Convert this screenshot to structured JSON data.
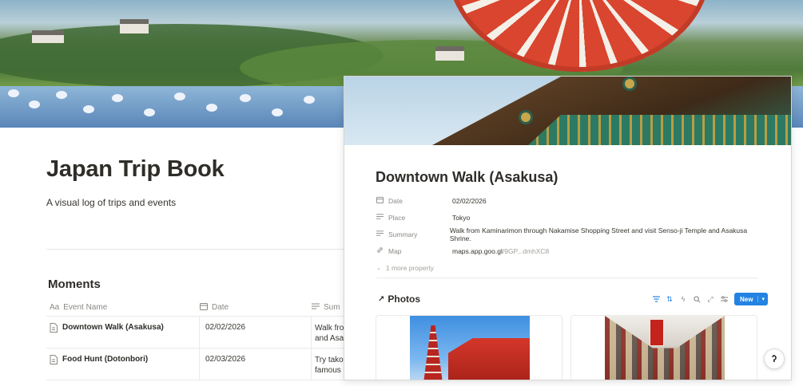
{
  "page": {
    "title": "Japan Trip Book",
    "description": "A visual log of trips and events",
    "section_title": "Moments"
  },
  "table": {
    "columns": [
      {
        "label": "Event Name",
        "icon": "text-property-icon"
      },
      {
        "label": "Date",
        "icon": "calendar-icon"
      },
      {
        "label": "Sum",
        "icon": "text-lines-icon"
      }
    ],
    "rows": [
      {
        "name": "Downtown Walk (Asakusa)",
        "date": "02/02/2026",
        "summary_l1": "Walk fro",
        "summary_l2": "and Asa"
      },
      {
        "name": "Food Hunt (Dotonbori)",
        "date": "02/03/2026",
        "summary_l1": "Try tako",
        "summary_l2": "famous"
      }
    ]
  },
  "peek": {
    "title": "Downtown Walk (Asakusa)",
    "properties": [
      {
        "key": "Date",
        "icon": "calendar-icon",
        "value": "02/02/2026"
      },
      {
        "key": "Place",
        "icon": "text-lines-icon",
        "value": "Tokyo"
      },
      {
        "key": "Summary",
        "icon": "text-lines-icon",
        "value": "Walk from Kaminarimon through Nakamise Shopping Street and visit Senso-ji Temple and Asakusa Shrine."
      },
      {
        "key": "Map",
        "icon": "link-icon",
        "value": "maps.app.goo.gl",
        "value_rest": "/9GP...dmhXC8"
      }
    ],
    "more_label": "1 more property",
    "photos_label": "Photos",
    "new_label": "New"
  },
  "colors": {
    "accent": "#2383e2",
    "text": "#37352f",
    "muted": "#8a8883"
  }
}
